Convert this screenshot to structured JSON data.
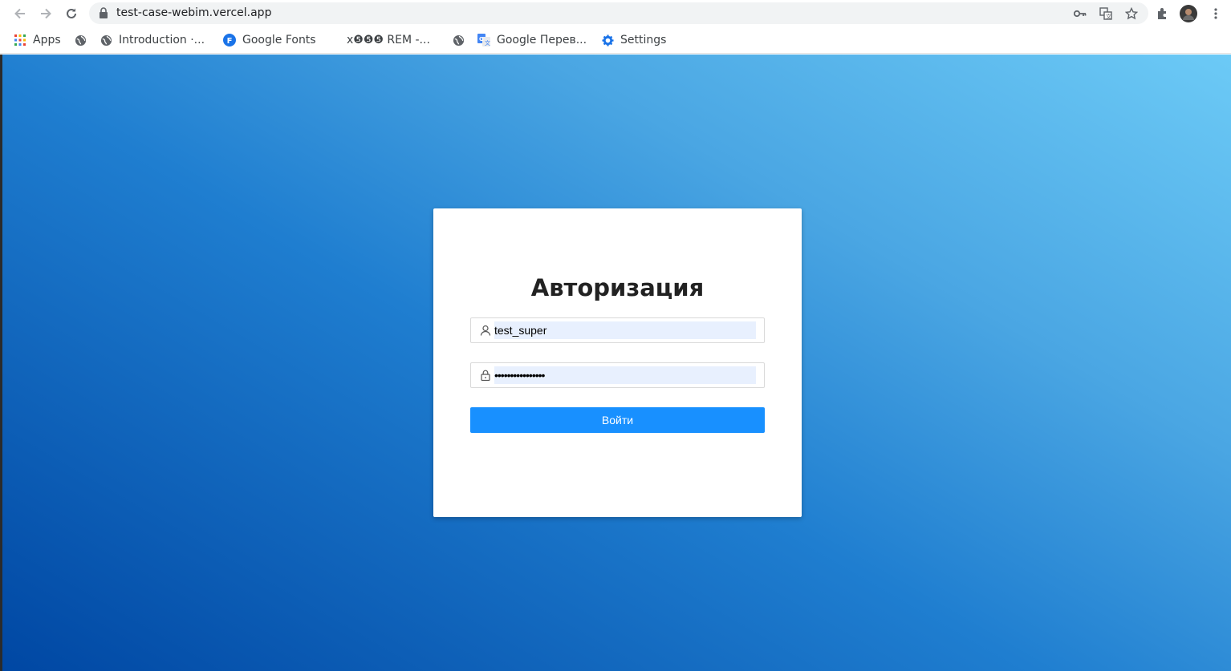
{
  "browser": {
    "url": "test-case-webim.vercel.app",
    "bookmarks": [
      {
        "label": "Apps",
        "icon": "apps-grid-icon"
      },
      {
        "label": "",
        "icon": "globe-icon"
      },
      {
        "label": "Introduction ·...",
        "icon": "globe-icon"
      },
      {
        "label": "Google Fonts",
        "icon": "google-fonts-icon"
      },
      {
        "label": "x❺❺❺ REM -...",
        "icon": ""
      },
      {
        "label": "",
        "icon": "globe-icon"
      },
      {
        "label": "Google Перев...",
        "icon": "google-translate-icon"
      },
      {
        "label": "Settings",
        "icon": "gear-icon"
      }
    ]
  },
  "login": {
    "title": "Авторизация",
    "username_value": "test_super",
    "password_value": "••••••••••••••••",
    "submit_label": "Войти"
  },
  "colors": {
    "primary": "#1890ff",
    "gradient_start": "#0047a3",
    "gradient_end": "#6ccaf6"
  }
}
